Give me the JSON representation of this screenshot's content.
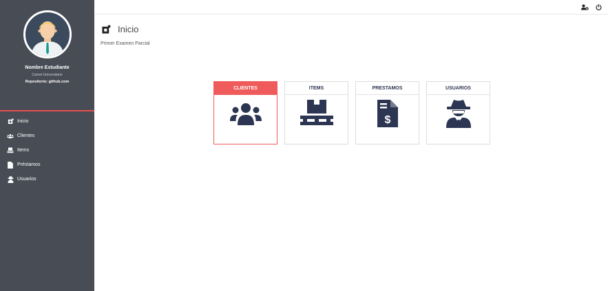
{
  "profile": {
    "name": "Nombre Estudiante",
    "carnet": "Carnet Universitario",
    "repo": "Repositorio: github.com"
  },
  "sidebar": {
    "items": [
      {
        "label": "Inicio",
        "icon": "dashboard-icon"
      },
      {
        "label": "Clientes",
        "icon": "users-icon"
      },
      {
        "label": "Items",
        "icon": "pallet-icon"
      },
      {
        "label": "Préstamos",
        "icon": "file-invoice-icon"
      },
      {
        "label": "Usuarios",
        "icon": "user-secret-icon"
      }
    ]
  },
  "topbar": {
    "icons": [
      "user-settings-icon",
      "power-icon"
    ]
  },
  "page": {
    "title": "Inicio",
    "subtitle": "Primer Examen Parcial"
  },
  "cards": [
    {
      "label": "CLIENTES",
      "icon": "users-icon",
      "active": true
    },
    {
      "label": "ITEMS",
      "icon": "pallet-icon",
      "active": false
    },
    {
      "label": "PRESTAMOS",
      "icon": "file-invoice-dollar-icon",
      "active": false
    },
    {
      "label": "USUARIOS",
      "icon": "user-secret-icon",
      "active": false
    }
  ],
  "colors": {
    "sidebar": "#484c55",
    "accent": "#ef5b5b",
    "icon_dark": "#2c3552"
  }
}
